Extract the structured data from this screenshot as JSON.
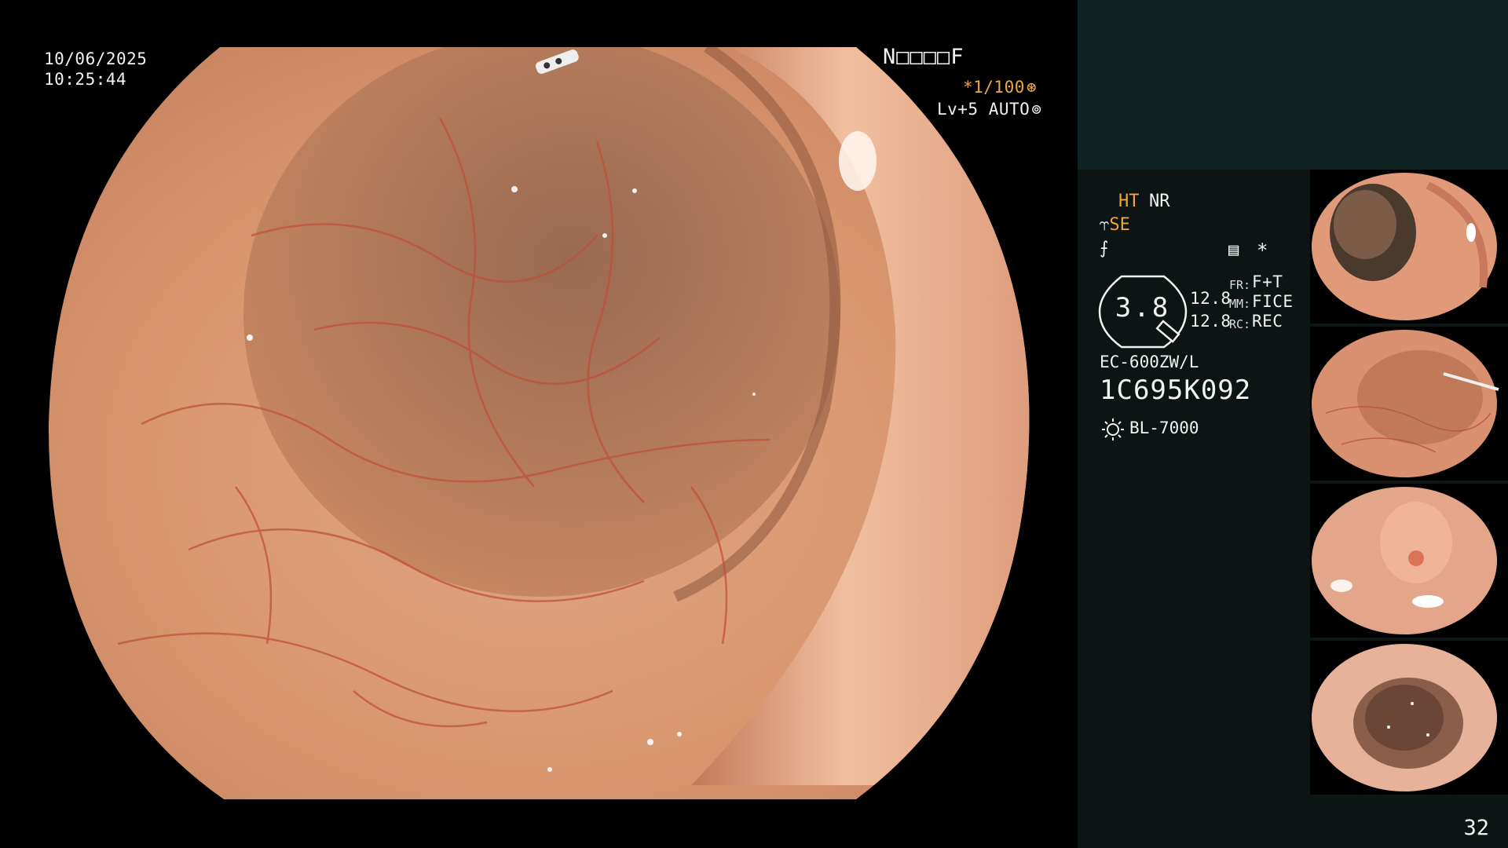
{
  "overlay": {
    "date": "10/06/2025",
    "time": "10:25:44",
    "patient_id": "N□□□□F",
    "shutter": "*1/100",
    "level": "Lv+5 AUTO"
  },
  "panel": {
    "ht": "HT",
    "nr": "NR",
    "se": "SE",
    "zoom": "3.8",
    "value_1": "12.8",
    "value_2": "12.8",
    "fr_label": "FR:",
    "fr_value": "F+T",
    "mm_label": "MM:",
    "mm_value": "FICE",
    "rc_label": "RC:",
    "rc_value": "REC",
    "scope_model": "EC-600ZW/L",
    "scope_serial": "1C695K092",
    "light_source": "BL-7000",
    "page_number": "32"
  },
  "thumbnails": [
    {
      "label": "thumbnail-1"
    },
    {
      "label": "thumbnail-2"
    },
    {
      "label": "thumbnail-3"
    },
    {
      "label": "thumbnail-4"
    }
  ],
  "colors": {
    "tissue": "#d99a78",
    "tissue_dark": "#b8704f",
    "vessel": "#c0503a",
    "accent_orange": "#f0a640",
    "panel_bg": "#0c1414",
    "panel_top": "#0e2324"
  }
}
